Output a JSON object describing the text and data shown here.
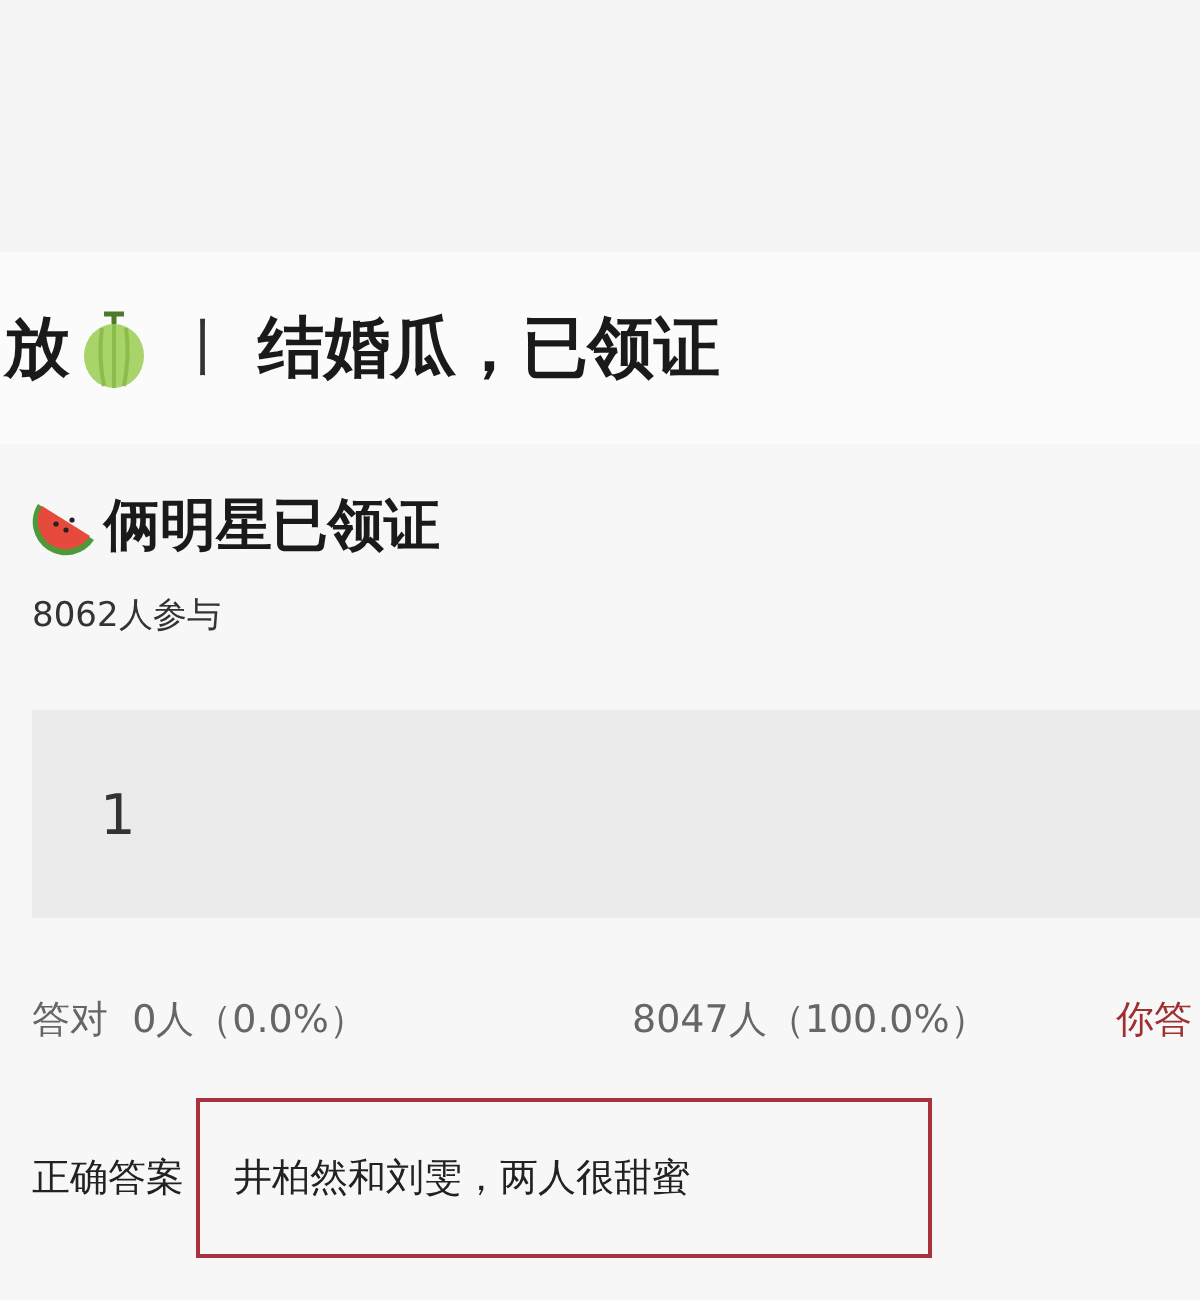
{
  "headline": {
    "text_before": "放",
    "separator": "丨",
    "text_after": "结婚瓜，已领证"
  },
  "poll": {
    "title": "俩明星已领证",
    "participants": "8062人参与",
    "option": {
      "label": "1",
      "level": 1
    },
    "stats": {
      "correct": "答对  0人（0.0%）",
      "wrong": "8047人（100.0%）",
      "verdict": "你答"
    },
    "answer": {
      "label": "正确答案",
      "text": "井柏然和刘雯，两人很甜蜜",
      "highlighted": true
    }
  }
}
